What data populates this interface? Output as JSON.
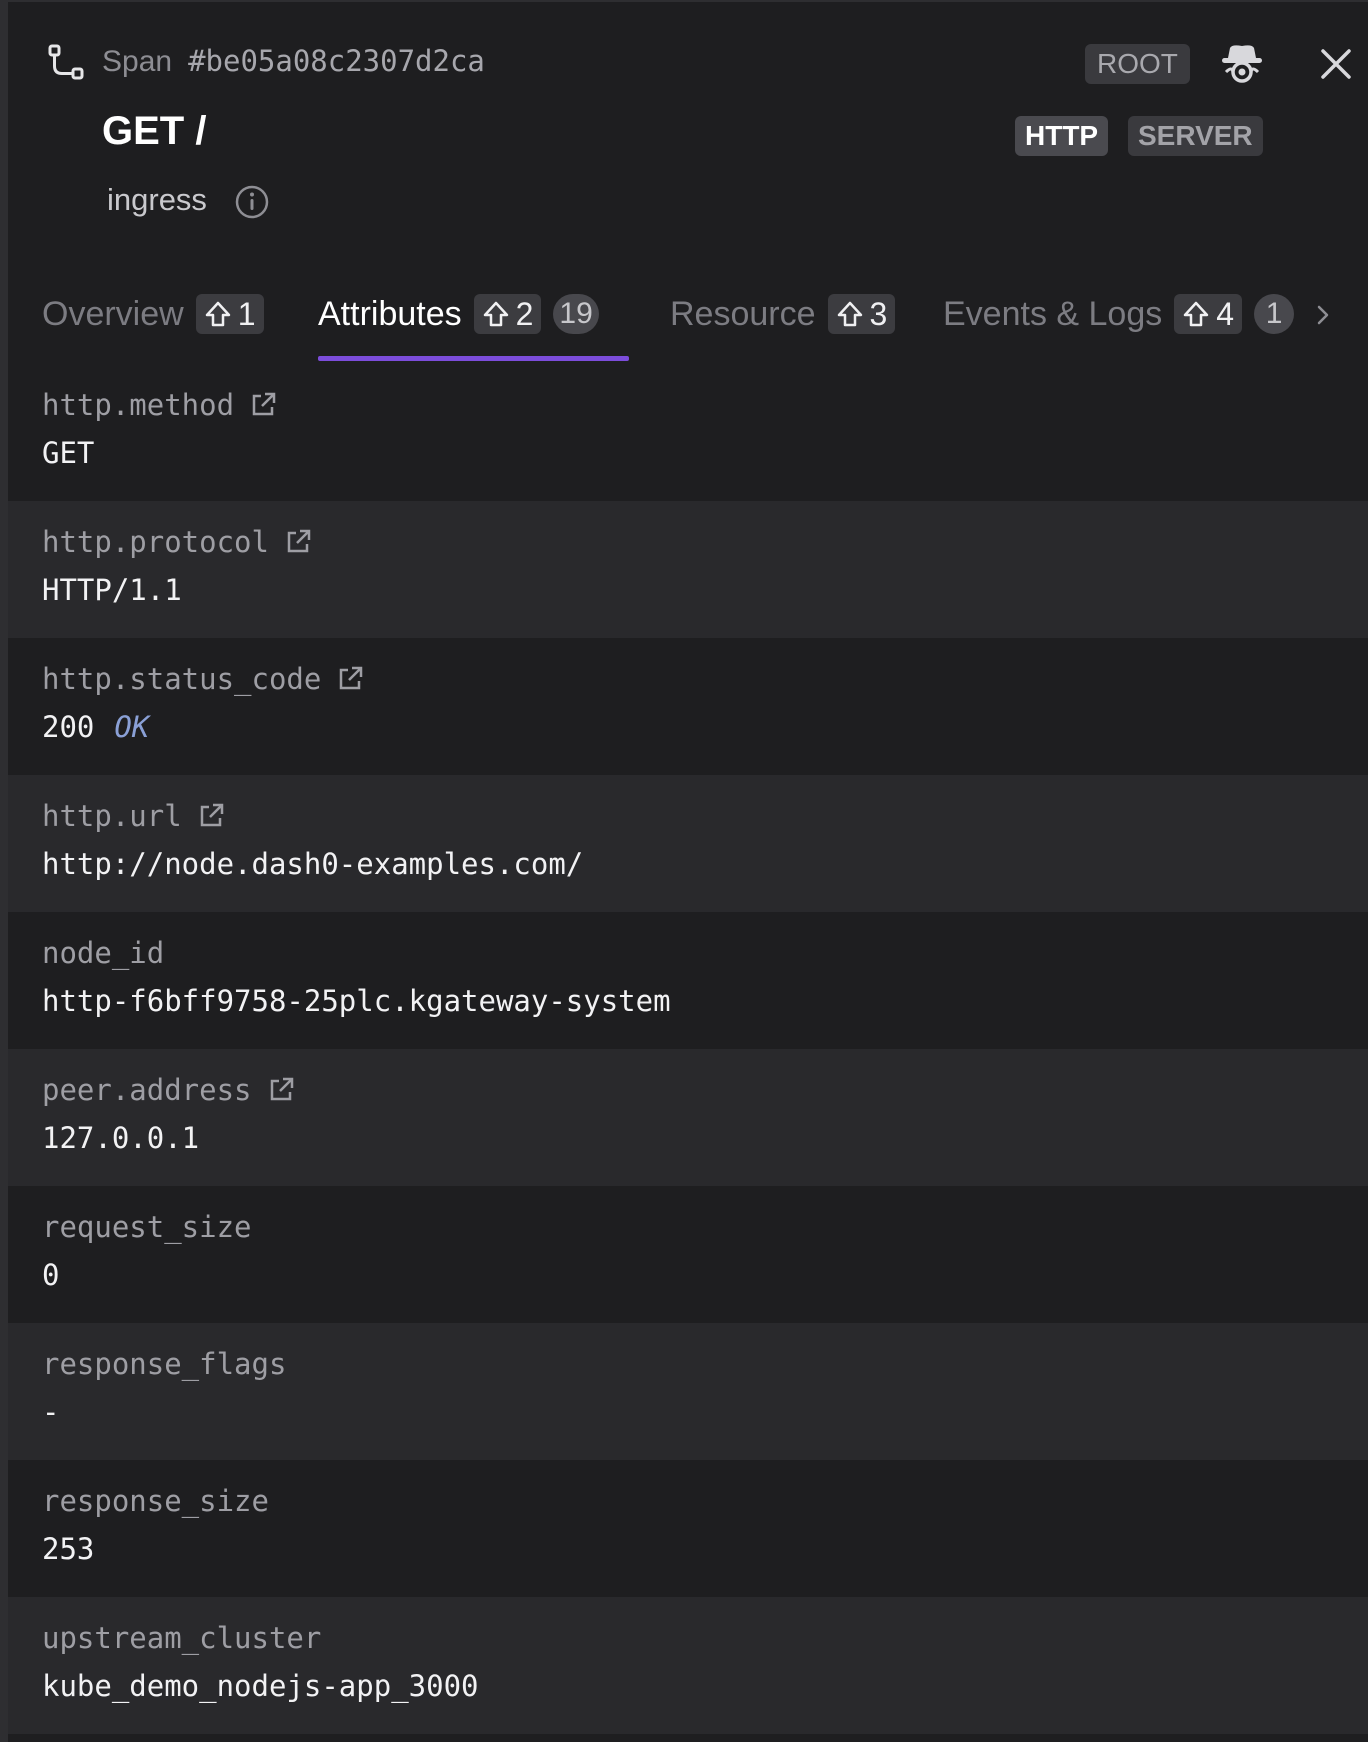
{
  "header": {
    "span_label": "Span",
    "span_id": "#be05a08c2307d2ca",
    "root_badge": "ROOT",
    "title": "GET /",
    "tags": [
      "HTTP",
      "SERVER"
    ],
    "service": "ingress"
  },
  "tabs": [
    {
      "label": "Overview",
      "shortcut": "1",
      "count": null,
      "active": false
    },
    {
      "label": "Attributes",
      "shortcut": "2",
      "count": "19",
      "active": true
    },
    {
      "label": "Resource",
      "shortcut": "3",
      "count": null,
      "active": false
    },
    {
      "label": "Events & Logs",
      "shortcut": "4",
      "count": "1",
      "active": false
    }
  ],
  "attributes": [
    {
      "key": "http.method",
      "value": "GET",
      "link": true
    },
    {
      "key": "http.protocol",
      "value": "HTTP/1.1",
      "link": true
    },
    {
      "key": "http.status_code",
      "value": "200",
      "status_text": "OK",
      "link": true
    },
    {
      "key": "http.url",
      "value": "http://node.dash0-examples.com/",
      "link": true
    },
    {
      "key": "node_id",
      "value": "http-f6bff9758-25plc.kgateway-system",
      "link": false
    },
    {
      "key": "peer.address",
      "value": "127.0.0.1",
      "link": true
    },
    {
      "key": "request_size",
      "value": "0",
      "link": false
    },
    {
      "key": "response_flags",
      "value": "-",
      "link": false
    },
    {
      "key": "response_size",
      "value": "253",
      "link": false
    },
    {
      "key": "upstream_cluster",
      "value": "kube_demo_nodejs-app_3000",
      "link": false
    }
  ],
  "colors": {
    "background": "#1e1e20",
    "row_alt": "#29292c",
    "accent": "#7c4ddb",
    "status_text": "#8aa0d6"
  },
  "icons": {
    "span": "span-route-icon",
    "observer": "spy-hat-icon",
    "close": "close-icon",
    "info": "info-icon",
    "external": "external-link-icon",
    "shift": "shift-key-icon",
    "next": "chevron-right-icon"
  }
}
